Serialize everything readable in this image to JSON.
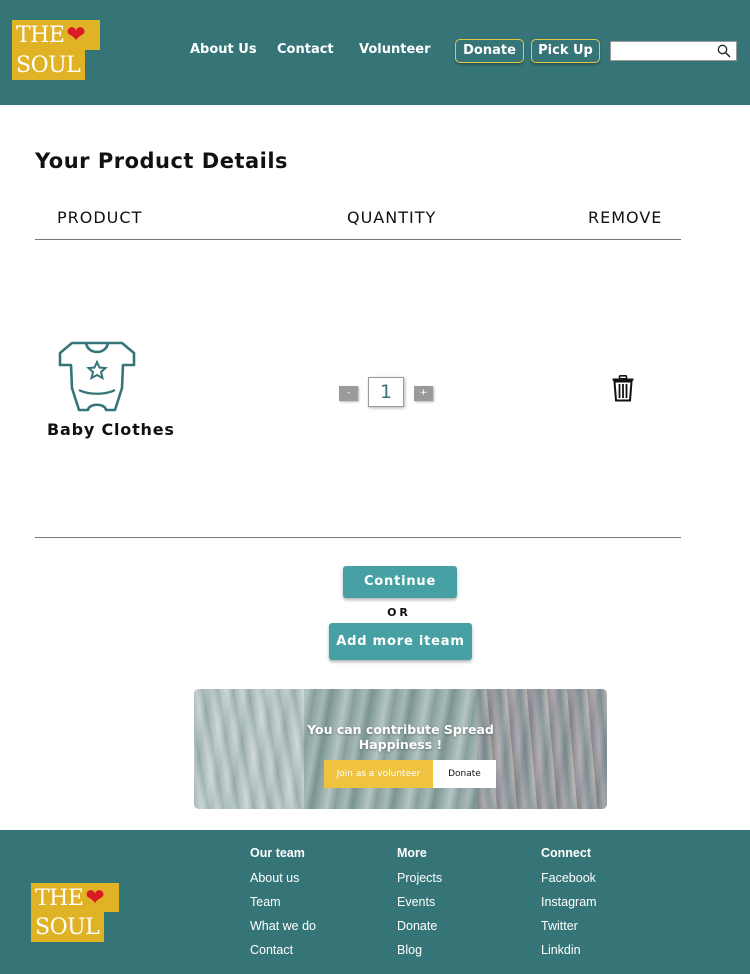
{
  "header": {
    "logo": {
      "line1": "THE",
      "line2": "SOUL",
      "heart": "❤"
    },
    "nav": [
      "About Us",
      "Contact",
      "Volunteer"
    ],
    "donate_label": "Donate",
    "pickup_label": "Pick Up",
    "search": {
      "value": "",
      "placeholder": "",
      "icon": "search-icon"
    }
  },
  "main": {
    "title": "Your Product Details",
    "columns": {
      "product": "PRODUCT",
      "quantity": "QUANTITY",
      "remove": "REMOVE"
    },
    "item": {
      "name": "Baby Clothes",
      "icon": "baby-onesie-icon",
      "quantity": "1",
      "minus": "-",
      "plus": "+",
      "remove_icon": "trash-icon"
    },
    "continue_label": "Continue",
    "or_label": "OR",
    "add_more_label": "Add more iteam"
  },
  "banner": {
    "text_line1": "You can contribute Spread",
    "text_line2": "Happiness !",
    "join_label": "Join as a volunteer",
    "donate_label": "Donate"
  },
  "footer": {
    "logo": {
      "line1": "THE",
      "line2": "SOUL",
      "heart": "❤"
    },
    "columns": [
      {
        "heading": "Our team",
        "links": [
          "About us",
          "Team",
          "What we do",
          "Contact"
        ]
      },
      {
        "heading": "More",
        "links": [
          "Projects",
          "Events",
          "Donate",
          "Blog"
        ]
      },
      {
        "heading": "Connect",
        "links": [
          "Facebook",
          "Instagram",
          "Twitter",
          "Linkdin"
        ]
      }
    ]
  },
  "colors": {
    "header_bg": "#357578",
    "logo_bg": "#e0b226",
    "heart": "#d81b25",
    "button_teal": "#47a1a4",
    "join_yellow": "#efc33f",
    "button_border_yellow": "#e7c844"
  }
}
